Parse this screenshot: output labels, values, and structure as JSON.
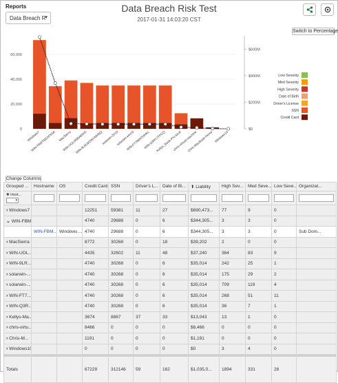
{
  "reports": {
    "label": "Reports",
    "selected": "Data Breach R",
    "caret": "▾"
  },
  "header": {
    "title": "Data Breach Risk Test",
    "timestamp": "2017-01-31 14:03:20 CST",
    "share_icon": "share-icon",
    "settings_icon": "gear-icon"
  },
  "switch_button": "Switch to Percentage",
  "chart_data": {
    "type": "bar",
    "stacked": true,
    "categories": [
      "Windows7",
      "WIN-FBMTNSXF5SA",
      "MacSierra",
      "WIN-UOL0R8IA8WG",
      "WIN-9LRUKDNYMHBQ",
      "solarwin-2019",
      "solarwin-win10",
      "WIN-FT7NIRTHHKL",
      "WIN-Q3RYJTPGQ",
      "Kellys_Book-Pro.local",
      "chris-virtual-machine",
      "Chris-MacBook-Home",
      "Windows10"
    ],
    "series": [
      {
        "name": "Credit Card",
        "color": "#6b1a0a",
        "values": [
          12251,
          4740,
          8772,
          4435,
          4740,
          4740,
          4740,
          4740,
          4740,
          3674,
          8466,
          1191,
          0
        ]
      },
      {
        "name": "SSN",
        "color": "#e8542a",
        "values": [
          59381,
          29688,
          30268,
          32602,
          30268,
          30268,
          30268,
          30268,
          30268,
          8867,
          0,
          0,
          0
        ]
      },
      {
        "name": "Driver's License",
        "color": "#f5a623",
        "values": [
          11,
          0,
          0,
          11,
          0,
          0,
          0,
          0,
          0,
          37,
          0,
          0,
          0
        ]
      },
      {
        "name": "Date of Birth",
        "color": "#e8a07a",
        "values": [
          27,
          6,
          18,
          48,
          6,
          6,
          6,
          6,
          6,
          33,
          0,
          0,
          0
        ]
      },
      {
        "name": "High Severity",
        "color": "#c0392b",
        "values": [
          0,
          0,
          0,
          0,
          0,
          0,
          0,
          0,
          0,
          0,
          0,
          0,
          0
        ]
      },
      {
        "name": "Med Severity",
        "color": "#f39c12",
        "values": [
          0,
          0,
          0,
          0,
          0,
          0,
          0,
          0,
          0,
          0,
          0,
          0,
          0
        ]
      },
      {
        "name": "Low Severity",
        "color": "#8bc34a",
        "values": [
          0,
          0,
          0,
          0,
          0,
          0,
          0,
          0,
          0,
          0,
          0,
          0,
          0
        ]
      }
    ],
    "liability": [
      690473,
      344305,
      39202,
      37240,
      35014,
      35014,
      35014,
      35014,
      35014,
      13043,
      8466,
      1191,
      0
    ],
    "ylim": [
      0,
      75000
    ],
    "y_ticks": [
      "0",
      "20,000",
      "40,000",
      "60,000"
    ],
    "y2_ticks": [
      "$0",
      "$200M",
      "$400M",
      "$600M"
    ],
    "y2lim": [
      0,
      700
    ],
    "legend_order": [
      "Low Severity",
      "Med Severity",
      "High Severity",
      "Date of Birth",
      "Driver's License",
      "SSN",
      "Credit Card"
    ],
    "legend_position": "right"
  },
  "table": {
    "change_columns": "Change Columns",
    "columns": [
      "Grouped ...",
      "Hostname",
      "OS",
      "Credit Card",
      "SSN",
      "Driver's L...",
      "Date of Bi...",
      "Liability",
      "High Sev...",
      "Med Seve...",
      "Low Seve...",
      "Organizat..."
    ],
    "group_chip": "✖ Host...",
    "rows": [
      {
        "kind": "grp",
        "arrow": "›",
        "cells": [
          "Windows7",
          "",
          "",
          "12251",
          "59381",
          "11",
          "27",
          "$690,473...",
          "77",
          "9",
          "0",
          ""
        ]
      },
      {
        "kind": "grp",
        "arrow": "⌄",
        "cells": [
          "WIN-FBM...",
          "",
          "",
          "4740",
          "29688",
          "0",
          "6",
          "$344,305...",
          "3",
          "3",
          "0",
          ""
        ]
      },
      {
        "kind": "detail",
        "arrow": "",
        "cells": [
          "",
          "WIN-FBM...",
          "Windows ...",
          "4740",
          "29688",
          "0",
          "6",
          "$344,305...",
          "3",
          "3",
          "0",
          "Sub Dom..."
        ]
      },
      {
        "kind": "grp",
        "arrow": "›",
        "cells": [
          "MacSierra",
          "",
          "",
          "8772",
          "30268",
          "0",
          "18",
          "$39,202",
          "2",
          "0",
          "0",
          ""
        ]
      },
      {
        "kind": "grp",
        "arrow": "›",
        "cells": [
          "WIN-UOL...",
          "",
          "",
          "4435",
          "32602",
          "11",
          "48",
          "$37,240",
          "364",
          "83",
          "9",
          ""
        ]
      },
      {
        "kind": "grp",
        "arrow": "›",
        "cells": [
          "WIN-9LR...",
          "",
          "",
          "4740",
          "30268",
          "0",
          "6",
          "$35,014",
          "242",
          "25",
          "1",
          ""
        ]
      },
      {
        "kind": "grp",
        "arrow": "›",
        "cells": [
          "solarwin-...",
          "",
          "",
          "4740",
          "30268",
          "0",
          "6",
          "$35,014",
          "175",
          "29",
          "2",
          ""
        ]
      },
      {
        "kind": "grp",
        "arrow": "›",
        "cells": [
          "solarwin-...",
          "",
          "",
          "4740",
          "30268",
          "0",
          "6",
          "$35,014",
          "709",
          "119",
          "4",
          ""
        ]
      },
      {
        "kind": "grp",
        "arrow": "›",
        "cells": [
          "WIN-FT7...",
          "",
          "",
          "4740",
          "30268",
          "0",
          "6",
          "$35,014",
          "268",
          "51",
          "11",
          ""
        ]
      },
      {
        "kind": "grp",
        "arrow": "›",
        "cells": [
          "WIN-Q3R...",
          "",
          "",
          "4740",
          "30268",
          "0",
          "6",
          "$35,014",
          "36",
          "7",
          "1",
          ""
        ]
      },
      {
        "kind": "grp",
        "arrow": "›",
        "cells": [
          "Kellys-Ma...",
          "",
          "",
          "3674",
          "8867",
          "37",
          "33",
          "$13,043",
          "13",
          "1",
          "0",
          ""
        ]
      },
      {
        "kind": "grp",
        "arrow": "›",
        "cells": [
          "chris-virtu...",
          "",
          "",
          "8466",
          "0",
          "0",
          "0",
          "$8,466",
          "0",
          "0",
          "0",
          ""
        ]
      },
      {
        "kind": "grp",
        "arrow": "›",
        "cells": [
          "Chris-M...",
          "",
          "",
          "1191",
          "0",
          "0",
          "0",
          "$1,191",
          "0",
          "0",
          "0",
          ""
        ]
      },
      {
        "kind": "grp",
        "arrow": "›",
        "cells": [
          "Windows10",
          "",
          "",
          "0",
          "0",
          "0",
          "0",
          "$0",
          "3",
          "4",
          "0",
          ""
        ]
      }
    ],
    "totals": [
      "Totals",
      "",
      "",
      "67229",
      "312146",
      "59",
      "162",
      "$1,035,0...",
      "1894",
      "331",
      "28",
      ""
    ]
  }
}
